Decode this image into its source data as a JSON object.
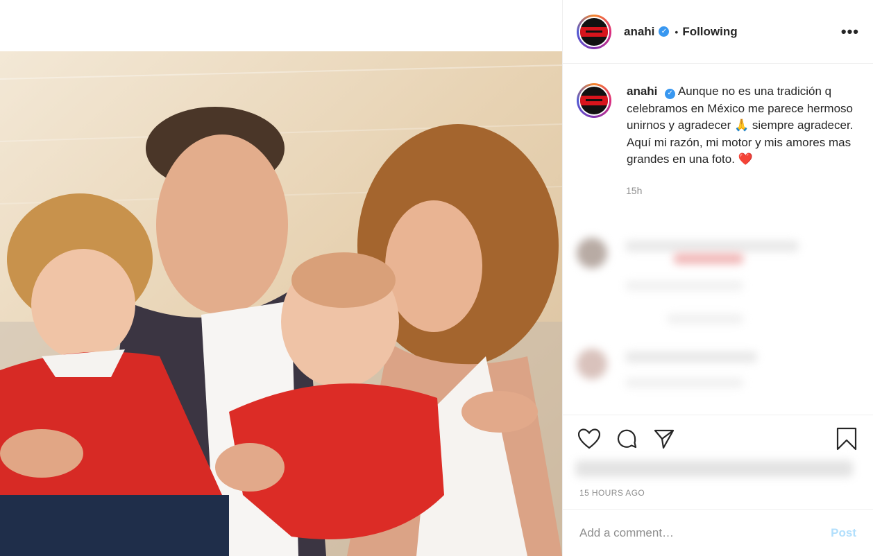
{
  "post": {
    "username": "anahi",
    "follow_status": "Following",
    "more_label": "•••",
    "caption_username": "anahi",
    "caption_text": "Aunque no es una tradición q celebramos en México me parece hermoso unirnos y agradecer 🙏 siempre agradecer. Aquí mi razón, mi motor y mis amores mas grandes en una foto. ❤️",
    "caption_time": "15h",
    "time_ago": "15 HOURS AGO"
  },
  "comment_box": {
    "placeholder": "Add a comment…",
    "post_label": "Post"
  },
  "icons": [
    "heart-icon",
    "comment-icon",
    "share-icon",
    "bookmark-icon",
    "verified-icon"
  ],
  "colors": {
    "accent": "#3897f0",
    "post_disabled": "#b2dffc",
    "meta": "#8e8e8e"
  }
}
